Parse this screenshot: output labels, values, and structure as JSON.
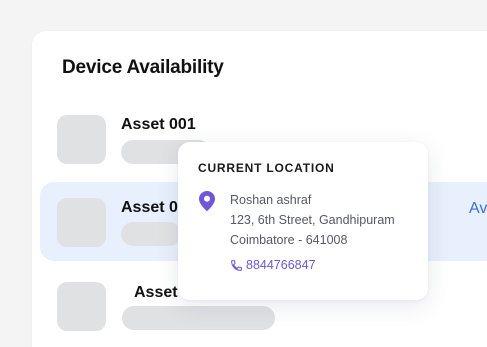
{
  "card": {
    "title": "Device Availability"
  },
  "assets": [
    {
      "name": "Asset 001"
    },
    {
      "name": "Asset 00"
    },
    {
      "name": "Asset"
    }
  ],
  "highlight_row": {
    "status_label": "Av"
  },
  "popover": {
    "title": "CURRENT LOCATION",
    "contact_name": "Roshan ashraf",
    "address_line1": "123, 6th Street, Gandhipuram",
    "address_line2": "Coimbatore - 641008",
    "phone": "8844766847",
    "pin_icon": "location-pin-icon",
    "phone_icon": "phone-icon"
  },
  "colors": {
    "accent_blue": "#3b6fd8",
    "highlight_bg": "#e8f0fd",
    "pin_purple": "#7056d8",
    "skeleton": "#dfe1e3"
  }
}
